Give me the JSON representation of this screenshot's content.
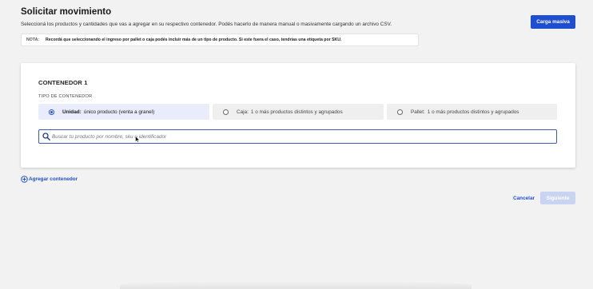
{
  "header": {
    "title": "Solicitar movimiento",
    "subtitle": "Seleccioná los productos y cantidades que vas a agregar en su respectivo contenedor. Podés hacerlo de manera manual o masivamente cargando un archivo CSV.",
    "bulk_button": "Carga masiva"
  },
  "note": {
    "tag": "NOTA:",
    "text": "Recordá que seleccionando el ingreso por pallet o caja podés incluir más de un tipo de producto. Si este fuera el caso, tendrías una etiqueta por SKU."
  },
  "container": {
    "title": "CONTENEDOR 1",
    "type_label": "TIPO DE CONTENEDOR",
    "options": [
      {
        "name": "Unidad:",
        "desc": "único producto (venta a granel)",
        "selected": true
      },
      {
        "name": "Caja:",
        "desc": "1 o más productos distintos y agrupados",
        "selected": false
      },
      {
        "name": "Pallet:",
        "desc": "1 o más productos distintos y agrupados",
        "selected": false
      }
    ],
    "search": {
      "placeholder": "Buscar tu producto por nombre, sku o identificador",
      "value": ""
    }
  },
  "add_container_label": "Agregar contenedor",
  "footer": {
    "cancel_label": "Cancelar",
    "next_label": "Siguiente"
  },
  "colors": {
    "accent": "#1f4fd1",
    "disabled_button": "#c9d4f2",
    "selected_option_bg": "#e8ecfb",
    "background": "#f2f2f2"
  },
  "icons": [
    "search-icon",
    "radio-selected-icon",
    "radio-icon",
    "plus-circle-icon",
    "mouse-cursor-icon"
  ]
}
